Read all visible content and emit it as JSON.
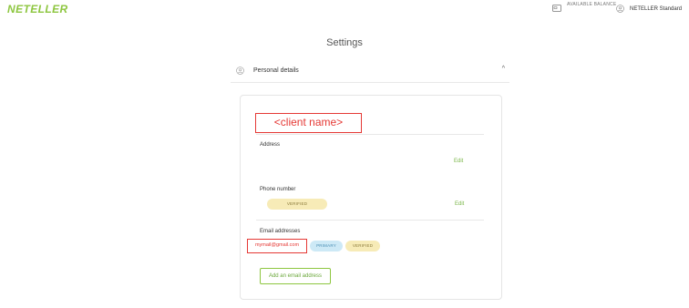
{
  "header": {
    "brand": "NETELLER",
    "balance_label": "AVAILABLE BALANCE",
    "account_label": "NETELLER Standard",
    "icons": {
      "balance": "wallet-icon",
      "account": "user-icon"
    }
  },
  "page": {
    "title": "Settings"
  },
  "personal_details": {
    "label": "Personal details",
    "icon": "user-icon",
    "caret": "^",
    "client_name": "<client name>",
    "address": {
      "label": "Address",
      "edit": "Edit"
    },
    "phone": {
      "label": "Phone number",
      "status": "VERIFIED",
      "edit": "Edit"
    },
    "email": {
      "label": "Email addresses",
      "value": "mymail@gmail.com",
      "badges": [
        "PRIMARY",
        "VERIFIED"
      ],
      "add_button": "Add an email address"
    }
  },
  "colors": {
    "brand": "#8dc63f",
    "annotation": "#e53935",
    "verified_bg": "#f7ebb7",
    "primary_bg": "#cde9f6"
  }
}
